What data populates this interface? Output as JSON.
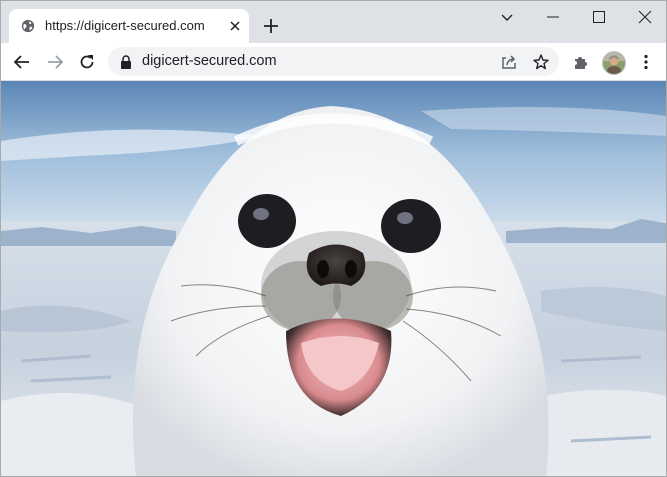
{
  "window": {
    "tab": {
      "title": "https://digicert-secured.com",
      "favicon": "globe-icon"
    },
    "controls": {
      "tab_search": "chevron-down-icon",
      "minimize": "minimize-icon",
      "maximize": "maximize-icon",
      "close": "close-icon"
    }
  },
  "toolbar": {
    "back": "back-arrow-icon",
    "forward": "forward-arrow-icon",
    "reload": "reload-icon",
    "omnibox": {
      "security_icon": "lock-icon",
      "url": "digicert-secured.com",
      "share_icon": "share-icon",
      "bookmark_icon": "star-icon"
    },
    "extensions_icon": "puzzle-icon",
    "profile": "avatar",
    "menu_icon": "kebab-menu-icon"
  },
  "page": {
    "image": "harp-seal-pup-photo"
  },
  "colors": {
    "frame": "#dee1e6",
    "toolbar": "#ffffff",
    "omnibox": "#f1f3f4",
    "text": "#202124",
    "icon": "#5f6368"
  }
}
